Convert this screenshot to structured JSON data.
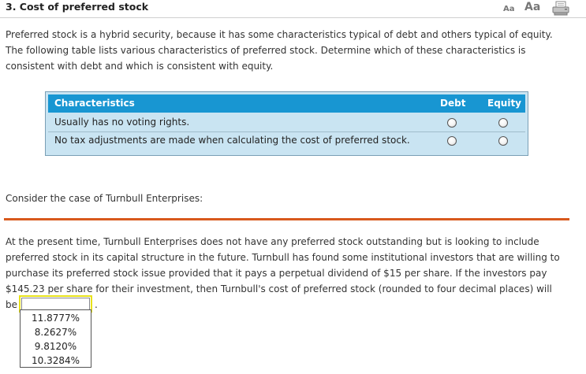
{
  "question": {
    "title": "3.  Cost of preferred stock"
  },
  "toolbar": {
    "font_small_label": "Aa",
    "font_large_label": "Aa",
    "print_icon": "printer-icon"
  },
  "intro": {
    "text": "Preferred stock is a hybrid security, because it has some characteristics typical of debt and others typical of equity. The following table lists various characteristics of preferred stock. Determine which of these characteristics is consistent with debt and which is consistent with equity."
  },
  "table": {
    "headers": {
      "characteristics": "Characteristics",
      "debt": "Debt",
      "equity": "Equity"
    },
    "rows": [
      {
        "text": "Usually has no voting rights."
      },
      {
        "text": "No tax adjustments are made when calculating the cost of preferred stock."
      }
    ],
    "colors": {
      "header_bg": "#1896d2",
      "body_bg": "#c9e4f2"
    }
  },
  "case": {
    "text": "Consider the case of Turnbull Enterprises:"
  },
  "problem": {
    "text": "At the present time, Turnbull Enterprises does not have any preferred stock outstanding but is looking to include preferred stock in its capital structure in the future. Turnbull has found some institutional investors that are willing to purchase its preferred stock issue provided that it pays a perpetual dividend of $15 per share. If the investors pay $145.23 per share for their investment, then Turnbull's cost of preferred stock (rounded to four decimal places) will",
    "prefix": "be",
    "suffix": ".",
    "selected_value": "",
    "options": [
      "11.8777%",
      "8.2627%",
      "9.8120%",
      "10.3284%"
    ]
  },
  "colors": {
    "accent_orange": "#d8591c",
    "dropdown_highlight": "#e8e21a"
  }
}
